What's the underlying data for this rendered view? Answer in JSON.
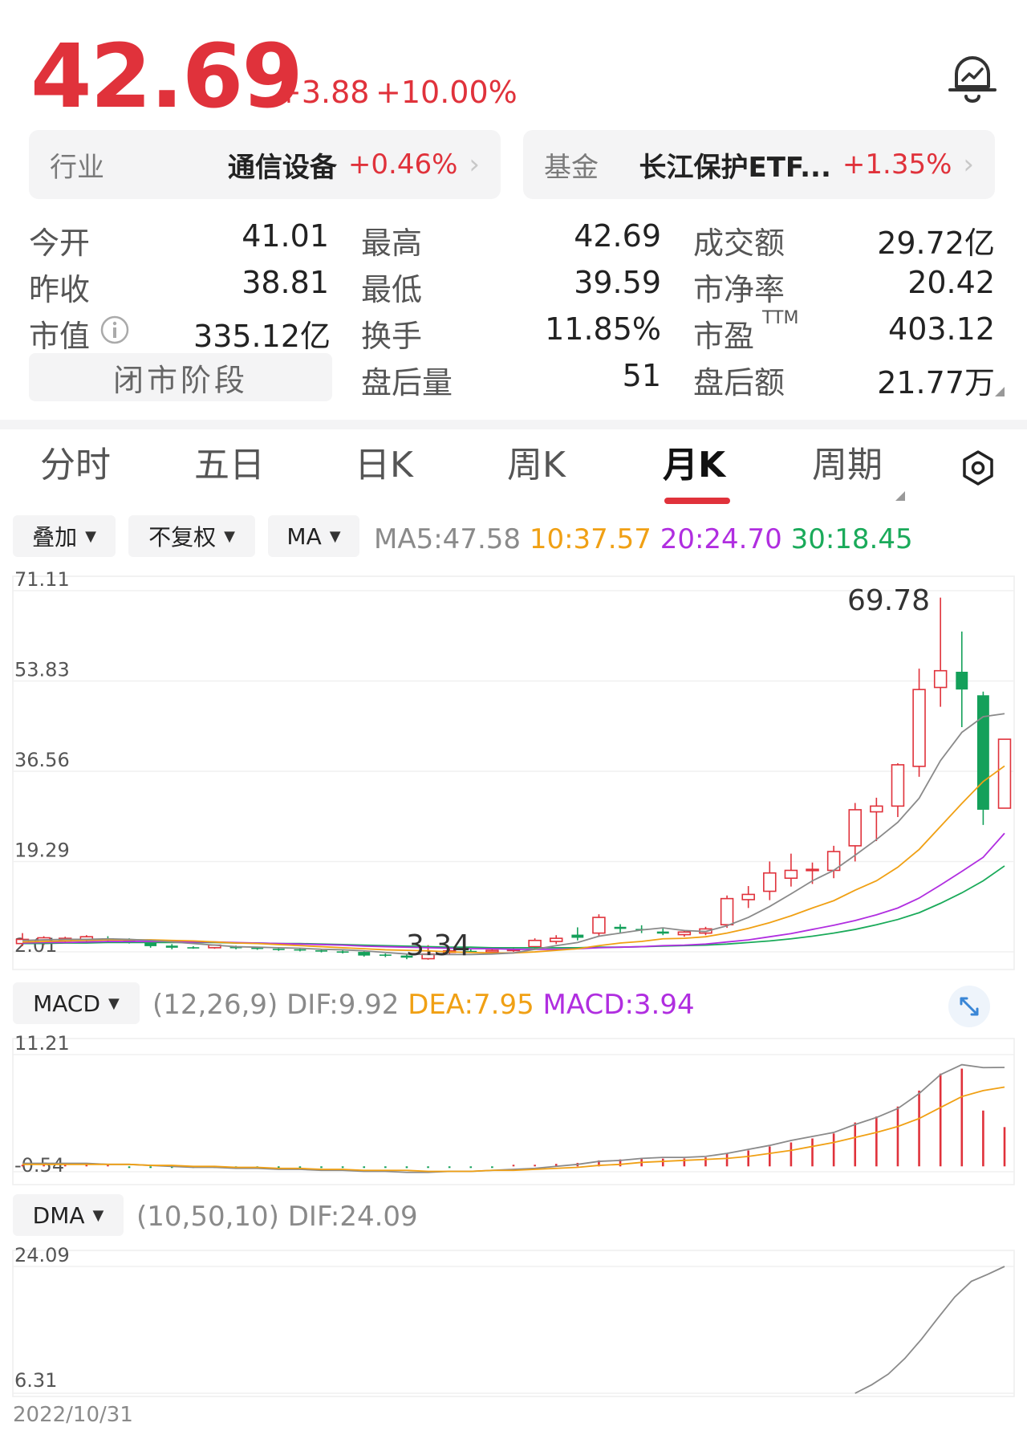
{
  "header": {
    "price": "42.69",
    "change": "+3.88",
    "change_pct": "+10.00%"
  },
  "pills": {
    "industry_label": "行业",
    "industry_name": "通信设备",
    "industry_pct": "+0.46%",
    "fund_label": "基金",
    "fund_name": "长江保护ETF...",
    "fund_pct": "+1.35%",
    "arrow": "›"
  },
  "stats": {
    "open_label": "今开",
    "open": "41.01",
    "prev_label": "昨收",
    "prev": "38.81",
    "mcap_label": "市值",
    "mcap": "335.12亿",
    "high_label": "最高",
    "high": "42.69",
    "low_label": "最低",
    "low": "39.59",
    "turnover_label": "换手",
    "turnover": "11.85%",
    "after_vol_label": "盘后量",
    "after_vol": "51",
    "amount_label": "成交额",
    "amount": "29.72亿",
    "pb_label": "市净率",
    "pb": "20.42",
    "pe_label": "市盈",
    "pe_sup": "TTM",
    "pe": "403.12",
    "after_amt_label": "盘后额",
    "after_amt": "21.77万",
    "market_state": "闭市阶段"
  },
  "tabs": [
    {
      "label": "分时"
    },
    {
      "label": "五日"
    },
    {
      "label": "日K"
    },
    {
      "label": "周K"
    },
    {
      "label": "月K"
    },
    {
      "label": "周期"
    }
  ],
  "controls": {
    "overlay": "叠加",
    "adjust": "不复权",
    "indicator": "MA",
    "caret": "▼"
  },
  "ma_line": {
    "ma5": "MA5:47.58",
    "ma10": "10:37.57",
    "ma20": "20:24.70",
    "ma30": "30:18.45"
  },
  "macd": {
    "selector": "MACD",
    "params": "(12,26,9)",
    "dif": "DIF:9.92",
    "dea": "DEA:7.95",
    "macd": "MACD:3.94"
  },
  "dma": {
    "selector": "DMA",
    "params": "(10,50,10)",
    "dif": "DIF:24.09"
  },
  "footer": {
    "date": "2022/10/31"
  },
  "colors": {
    "up": "#e0323b",
    "down": "#14a05a",
    "ma5": "#8a8a8a",
    "ma10": "#f0a014",
    "ma20": "#b02ee0",
    "ma30": "#1aaa5a"
  },
  "chart_data": [
    {
      "type": "candlestick",
      "title": "月K",
      "ylim": [
        2.01,
        71.11
      ],
      "y_ticks": [
        "71.11",
        "53.83",
        "36.56",
        "19.29",
        "2.01"
      ],
      "y_tick_values": [
        71.11,
        53.83,
        36.56,
        19.29,
        2.01
      ],
      "annotations": [
        {
          "text": "69.78",
          "value": 69.78
        },
        {
          "text": "3.34",
          "value": 3.34
        }
      ],
      "candles": [
        {
          "o": 3.6,
          "c": 4.4,
          "h": 5.6,
          "l": 3.1,
          "d": 0
        },
        {
          "o": 3.9,
          "c": 4.7,
          "h": 5.0,
          "l": 3.3,
          "d": 0
        },
        {
          "o": 4.1,
          "c": 4.6,
          "h": 4.9,
          "l": 3.7,
          "d": 0
        },
        {
          "o": 4.3,
          "c": 4.9,
          "h": 5.2,
          "l": 3.9,
          "d": 0
        },
        {
          "o": 4.6,
          "c": 4.3,
          "h": 5.0,
          "l": 3.9,
          "d": 1
        },
        {
          "o": 4.3,
          "c": 4.0,
          "h": 4.6,
          "l": 3.6,
          "d": 1
        },
        {
          "o": 3.9,
          "c": 3.1,
          "h": 4.3,
          "l": 2.8,
          "d": 1
        },
        {
          "o": 3.2,
          "c": 2.8,
          "h": 3.5,
          "l": 2.5,
          "d": 1
        },
        {
          "o": 2.8,
          "c": 2.9,
          "h": 3.1,
          "l": 2.6,
          "d": 1
        },
        {
          "o": 2.8,
          "c": 3.3,
          "h": 3.4,
          "l": 2.6,
          "d": 0
        },
        {
          "o": 3.0,
          "c": 2.7,
          "h": 3.2,
          "l": 2.5,
          "d": 1
        },
        {
          "o": 2.8,
          "c": 2.6,
          "h": 3.0,
          "l": 2.4,
          "d": 1
        },
        {
          "o": 2.6,
          "c": 2.4,
          "h": 2.8,
          "l": 2.2,
          "d": 1
        },
        {
          "o": 2.5,
          "c": 2.3,
          "h": 2.7,
          "l": 2.1,
          "d": 1
        },
        {
          "o": 2.3,
          "c": 2.1,
          "h": 2.5,
          "l": 1.9,
          "d": 1
        },
        {
          "o": 2.1,
          "c": 1.9,
          "h": 2.3,
          "l": 1.7,
          "d": 1
        },
        {
          "o": 2.0,
          "c": 1.3,
          "h": 2.2,
          "l": 1.1,
          "d": 1
        },
        {
          "o": 1.5,
          "c": 1.3,
          "h": 1.7,
          "l": 1.0,
          "d": 1
        },
        {
          "o": 1.3,
          "c": 0.9,
          "h": 1.6,
          "l": 0.6,
          "d": 1
        },
        {
          "o": 0.7,
          "c": 1.6,
          "h": 3.3,
          "l": 0.5,
          "d": 0
        },
        {
          "o": 1.9,
          "c": 2.2,
          "h": 2.6,
          "l": 1.6,
          "d": 0
        },
        {
          "o": 2.2,
          "c": 2.0,
          "h": 2.5,
          "l": 1.8,
          "d": 1
        },
        {
          "o": 2.0,
          "c": 2.3,
          "h": 2.6,
          "l": 1.7,
          "d": 0
        },
        {
          "o": 2.3,
          "c": 2.5,
          "h": 2.9,
          "l": 2.0,
          "d": 0
        },
        {
          "o": 3.0,
          "c": 4.2,
          "h": 4.6,
          "l": 2.4,
          "d": 0
        },
        {
          "o": 4.0,
          "c": 4.6,
          "h": 5.2,
          "l": 3.5,
          "d": 0
        },
        {
          "o": 4.7,
          "c": 5.3,
          "h": 6.7,
          "l": 4.2,
          "d": 1
        },
        {
          "o": 5.6,
          "c": 8.6,
          "h": 9.2,
          "l": 4.9,
          "d": 0
        },
        {
          "o": 6.8,
          "c": 6.4,
          "h": 7.3,
          "l": 5.6,
          "d": 1
        },
        {
          "o": 6.4,
          "c": 6.2,
          "h": 7.1,
          "l": 5.6,
          "d": 1
        },
        {
          "o": 5.9,
          "c": 5.5,
          "h": 6.6,
          "l": 5.2,
          "d": 1
        },
        {
          "o": 5.3,
          "c": 5.8,
          "h": 6.2,
          "l": 4.9,
          "d": 0
        },
        {
          "o": 5.6,
          "c": 6.4,
          "h": 6.8,
          "l": 5.2,
          "d": 0
        },
        {
          "o": 7.2,
          "c": 12.2,
          "h": 12.8,
          "l": 6.6,
          "d": 0
        },
        {
          "o": 12.0,
          "c": 13.0,
          "h": 14.6,
          "l": 10.4,
          "d": 0
        },
        {
          "o": 13.6,
          "c": 17.1,
          "h": 19.3,
          "l": 11.9,
          "d": 0
        },
        {
          "o": 16.1,
          "c": 17.6,
          "h": 20.8,
          "l": 14.5,
          "d": 0
        },
        {
          "o": 17.6,
          "c": 17.8,
          "h": 19.1,
          "l": 15.0,
          "d": 0
        },
        {
          "o": 17.6,
          "c": 21.2,
          "h": 22.3,
          "l": 16.1,
          "d": 0
        },
        {
          "o": 22.3,
          "c": 29.2,
          "h": 30.5,
          "l": 19.3,
          "d": 0
        },
        {
          "o": 28.8,
          "c": 29.9,
          "h": 31.5,
          "l": 23.2,
          "d": 0
        },
        {
          "o": 29.9,
          "c": 37.8,
          "h": 38.1,
          "l": 27.8,
          "d": 0
        },
        {
          "o": 37.5,
          "c": 52.2,
          "h": 56.2,
          "l": 35.5,
          "d": 0
        },
        {
          "o": 52.6,
          "c": 55.8,
          "h": 69.78,
          "l": 48.9,
          "d": 0
        },
        {
          "o": 55.6,
          "c": 52.2,
          "h": 63.3,
          "l": 45.0,
          "d": 1
        },
        {
          "o": 51.1,
          "c": 29.2,
          "h": 51.8,
          "l": 26.3,
          "d": 1
        },
        {
          "o": 29.5,
          "c": 42.69,
          "h": 42.69,
          "l": 29.5,
          "d": 0
        }
      ],
      "ma5": [
        4.2,
        4.3,
        4.4,
        4.4,
        4.5,
        4.4,
        4.2,
        3.9,
        3.6,
        3.3,
        3.0,
        2.9,
        2.8,
        2.7,
        2.5,
        2.4,
        2.2,
        1.9,
        1.6,
        1.5,
        1.5,
        1.5,
        1.6,
        1.8,
        2.5,
        3.2,
        3.8,
        5.0,
        5.6,
        6.2,
        6.6,
        6.1,
        5.9,
        7.0,
        8.6,
        10.7,
        13.1,
        15.6,
        17.6,
        20.5,
        23.5,
        26.8,
        31.4,
        38.6,
        44.0,
        47.0,
        47.58
      ],
      "ma10": [
        3.9,
        4.0,
        4.1,
        4.2,
        4.3,
        4.3,
        4.3,
        4.2,
        4.1,
        3.9,
        3.7,
        3.6,
        3.4,
        3.2,
        3.0,
        2.8,
        2.6,
        2.4,
        2.3,
        2.2,
        2.0,
        1.9,
        1.8,
        1.8,
        2.0,
        2.3,
        2.6,
        3.2,
        3.7,
        4.0,
        4.5,
        4.6,
        4.9,
        5.6,
        6.5,
        7.6,
        8.9,
        10.4,
        11.8,
        13.8,
        15.6,
        18.2,
        21.6,
        26.0,
        30.4,
        34.6,
        37.57
      ],
      "ma20": [
        3.7,
        3.8,
        3.8,
        3.9,
        4.0,
        4.0,
        4.0,
        4.0,
        3.9,
        3.9,
        3.8,
        3.7,
        3.6,
        3.5,
        3.4,
        3.3,
        3.1,
        3.0,
        2.9,
        2.8,
        2.7,
        2.6,
        2.6,
        2.5,
        2.5,
        2.5,
        2.6,
        2.8,
        2.9,
        3.0,
        3.2,
        3.3,
        3.5,
        3.9,
        4.3,
        4.9,
        5.5,
        6.3,
        7.1,
        8.0,
        9.1,
        10.4,
        12.3,
        14.8,
        17.4,
        20.1,
        24.7
      ],
      "ma30": [
        3.6,
        3.6,
        3.7,
        3.7,
        3.8,
        3.8,
        3.8,
        3.8,
        3.8,
        3.8,
        3.7,
        3.7,
        3.6,
        3.6,
        3.5,
        3.4,
        3.3,
        3.2,
        3.1,
        3.0,
        2.9,
        2.9,
        2.8,
        2.8,
        2.8,
        2.8,
        2.8,
        2.9,
        2.9,
        3.0,
        3.1,
        3.2,
        3.3,
        3.5,
        3.8,
        4.1,
        4.5,
        5.0,
        5.6,
        6.3,
        7.2,
        8.2,
        9.5,
        11.3,
        13.3,
        15.6,
        18.45
      ]
    },
    {
      "type": "bar",
      "title": "MACD",
      "ylim": [
        -0.54,
        11.21
      ],
      "y_ticks": [
        "11.21",
        "-0.54"
      ],
      "y_tick_values": [
        11.21,
        -0.54
      ],
      "macd_bars": [
        0.02,
        0.02,
        0.02,
        0.01,
        0.0,
        -0.01,
        -0.02,
        -0.03,
        -0.04,
        -0.05,
        -0.06,
        -0.07,
        -0.08,
        -0.09,
        -0.1,
        -0.12,
        -0.13,
        -0.15,
        -0.17,
        -0.14,
        -0.1,
        -0.06,
        -0.03,
        0.0,
        0.1,
        0.25,
        0.35,
        0.6,
        0.7,
        0.75,
        0.78,
        0.8,
        0.9,
        1.3,
        1.6,
        2.0,
        2.4,
        2.8,
        3.3,
        4.4,
        5.0,
        6.0,
        7.6,
        9.3,
        9.8,
        5.6,
        3.94
      ],
      "dif": [
        0.3,
        0.3,
        0.3,
        0.3,
        0.2,
        0.2,
        0.1,
        0.0,
        -0.1,
        -0.1,
        -0.2,
        -0.2,
        -0.3,
        -0.3,
        -0.4,
        -0.4,
        -0.5,
        -0.5,
        -0.6,
        -0.6,
        -0.5,
        -0.5,
        -0.4,
        -0.3,
        -0.2,
        0.0,
        0.2,
        0.5,
        0.6,
        0.8,
        0.9,
        0.9,
        1.0,
        1.3,
        1.7,
        2.1,
        2.6,
        3.0,
        3.4,
        4.2,
        4.9,
        5.8,
        7.3,
        9.2,
        10.2,
        9.9,
        9.92
      ],
      "dea": [
        0.2,
        0.2,
        0.2,
        0.2,
        0.2,
        0.2,
        0.1,
        0.1,
        0.0,
        0.0,
        -0.1,
        -0.1,
        -0.2,
        -0.2,
        -0.3,
        -0.3,
        -0.4,
        -0.4,
        -0.4,
        -0.5,
        -0.5,
        -0.5,
        -0.4,
        -0.4,
        -0.3,
        -0.2,
        -0.1,
        0.1,
        0.2,
        0.4,
        0.5,
        0.6,
        0.7,
        0.8,
        1.0,
        1.3,
        1.6,
        2.0,
        2.4,
        2.9,
        3.4,
        4.0,
        4.8,
        5.9,
        7.0,
        7.6,
        7.95
      ]
    },
    {
      "type": "line",
      "title": "DMA",
      "ylim": [
        6.31,
        24.09
      ],
      "y_ticks": [
        "24.09",
        "6.31"
      ],
      "y_tick_values": [
        24.09,
        6.31
      ],
      "dif_tail_start_index": 39,
      "dif": [
        6.31,
        7.5,
        9.0,
        11.2,
        13.9,
        16.9,
        19.8,
        22.0,
        23.0,
        24.09
      ]
    }
  ]
}
